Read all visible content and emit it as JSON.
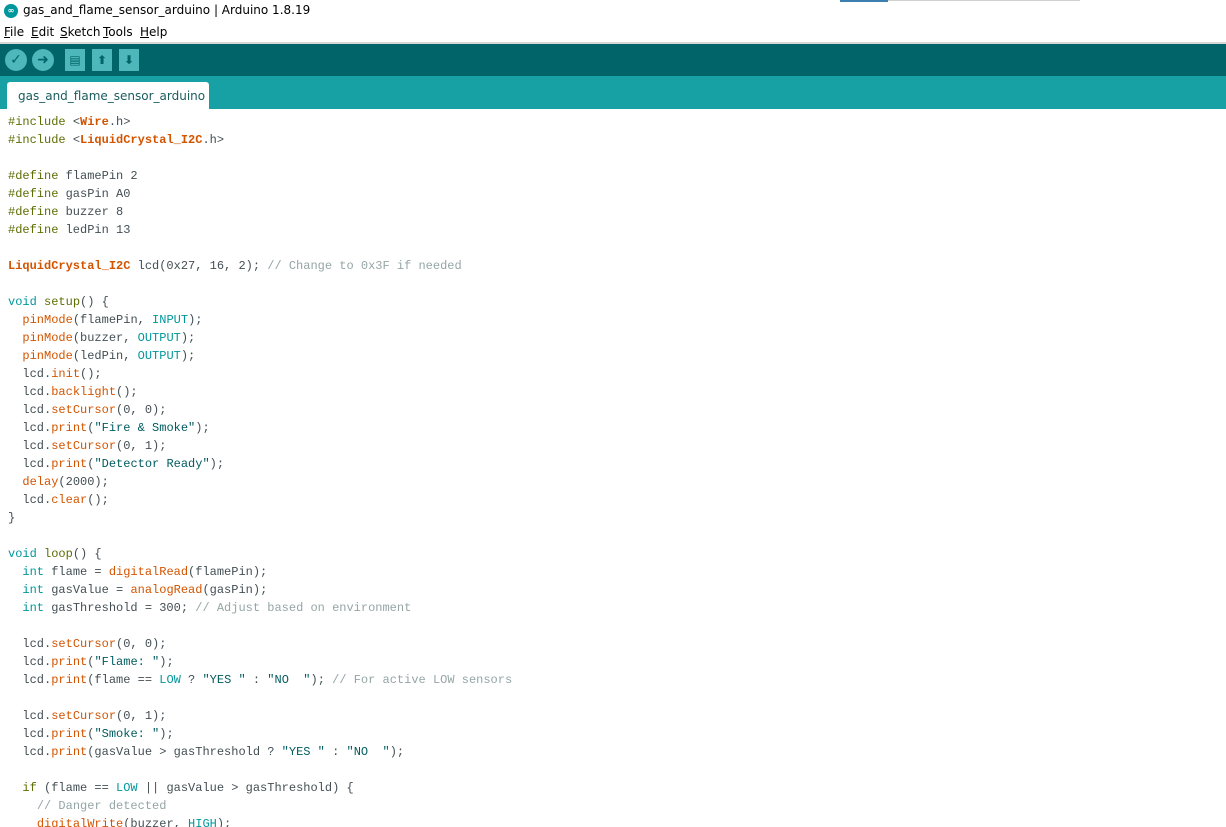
{
  "window": {
    "title": "gas_and_flame_sensor_arduino | Arduino 1.8.19"
  },
  "menu": {
    "items": [
      {
        "key": "F",
        "rest": "ile"
      },
      {
        "key": "E",
        "rest": "dit"
      },
      {
        "key": "S",
        "rest": "ketch"
      },
      {
        "key": "T",
        "rest": "ools"
      },
      {
        "key": "H",
        "rest": "elp"
      }
    ]
  },
  "toolbar": {
    "buttons": [
      {
        "name": "verify-button",
        "icon": "check-icon",
        "glyph": "✓"
      },
      {
        "name": "upload-button",
        "icon": "arrow-right-icon",
        "glyph": "➜"
      },
      {
        "name": "new-button",
        "icon": "new-file-icon",
        "glyph": "▤"
      },
      {
        "name": "open-button",
        "icon": "arrow-up-icon",
        "glyph": "⬆"
      },
      {
        "name": "save-button",
        "icon": "arrow-down-icon",
        "glyph": "⬇"
      }
    ]
  },
  "tab": {
    "label": "gas_and_flame_sensor_arduino"
  },
  "colors": {
    "toolbar": "#006468",
    "tabbar": "#17a1a5",
    "keyword": "#5e6d03",
    "type": "#00979c",
    "function": "#d35400",
    "string": "#005c5f",
    "comment": "#95a5a6"
  },
  "code": [
    [
      [
        "kw",
        "#include "
      ],
      [
        "pl",
        "<"
      ],
      [
        "cls",
        "Wire"
      ],
      [
        "pl",
        ".h>"
      ]
    ],
    [
      [
        "kw",
        "#include "
      ],
      [
        "pl",
        "<"
      ],
      [
        "cls",
        "LiquidCrystal_I2C"
      ],
      [
        "pl",
        ".h>"
      ]
    ],
    [],
    [
      [
        "kw",
        "#define "
      ],
      [
        "pl",
        "flamePin 2"
      ]
    ],
    [
      [
        "kw",
        "#define "
      ],
      [
        "pl",
        "gasPin A0"
      ]
    ],
    [
      [
        "kw",
        "#define "
      ],
      [
        "pl",
        "buzzer 8"
      ]
    ],
    [
      [
        "kw",
        "#define "
      ],
      [
        "pl",
        "ledPin 13"
      ]
    ],
    [],
    [
      [
        "cls",
        "LiquidCrystal_I2C"
      ],
      [
        "pl",
        " lcd(0x27, 16, 2); "
      ],
      [
        "cm",
        "// Change to 0x3F if needed"
      ]
    ],
    [],
    [
      [
        "ty",
        "void "
      ],
      [
        "kw",
        "setup"
      ],
      [
        "pl",
        "() {"
      ]
    ],
    [
      [
        "pl",
        "  "
      ],
      [
        "fn",
        "pinMode"
      ],
      [
        "pl",
        "(flamePin, "
      ],
      [
        "cn",
        "INPUT"
      ],
      [
        "pl",
        ");"
      ]
    ],
    [
      [
        "pl",
        "  "
      ],
      [
        "fn",
        "pinMode"
      ],
      [
        "pl",
        "(buzzer, "
      ],
      [
        "cn",
        "OUTPUT"
      ],
      [
        "pl",
        ");"
      ]
    ],
    [
      [
        "pl",
        "  "
      ],
      [
        "fn",
        "pinMode"
      ],
      [
        "pl",
        "(ledPin, "
      ],
      [
        "cn",
        "OUTPUT"
      ],
      [
        "pl",
        ");"
      ]
    ],
    [
      [
        "pl",
        "  lcd."
      ],
      [
        "fn",
        "init"
      ],
      [
        "pl",
        "();"
      ]
    ],
    [
      [
        "pl",
        "  lcd."
      ],
      [
        "fn",
        "backlight"
      ],
      [
        "pl",
        "();"
      ]
    ],
    [
      [
        "pl",
        "  lcd."
      ],
      [
        "fn",
        "setCursor"
      ],
      [
        "pl",
        "(0, 0);"
      ]
    ],
    [
      [
        "pl",
        "  lcd."
      ],
      [
        "fn",
        "print"
      ],
      [
        "pl",
        "("
      ],
      [
        "str",
        "\"Fire & Smoke\""
      ],
      [
        "pl",
        ");"
      ]
    ],
    [
      [
        "pl",
        "  lcd."
      ],
      [
        "fn",
        "setCursor"
      ],
      [
        "pl",
        "(0, 1);"
      ]
    ],
    [
      [
        "pl",
        "  lcd."
      ],
      [
        "fn",
        "print"
      ],
      [
        "pl",
        "("
      ],
      [
        "str",
        "\"Detector Ready\""
      ],
      [
        "pl",
        ");"
      ]
    ],
    [
      [
        "pl",
        "  "
      ],
      [
        "fn",
        "delay"
      ],
      [
        "pl",
        "(2000);"
      ]
    ],
    [
      [
        "pl",
        "  lcd."
      ],
      [
        "fn",
        "clear"
      ],
      [
        "pl",
        "();"
      ]
    ],
    [
      [
        "pl",
        "}"
      ]
    ],
    [],
    [
      [
        "ty",
        "void "
      ],
      [
        "kw",
        "loop"
      ],
      [
        "pl",
        "() {"
      ]
    ],
    [
      [
        "pl",
        "  "
      ],
      [
        "ty",
        "int"
      ],
      [
        "pl",
        " flame = "
      ],
      [
        "fn",
        "digitalRead"
      ],
      [
        "pl",
        "(flamePin);"
      ]
    ],
    [
      [
        "pl",
        "  "
      ],
      [
        "ty",
        "int"
      ],
      [
        "pl",
        " gasValue = "
      ],
      [
        "fn",
        "analogRead"
      ],
      [
        "pl",
        "(gasPin);"
      ]
    ],
    [
      [
        "pl",
        "  "
      ],
      [
        "ty",
        "int"
      ],
      [
        "pl",
        " gasThreshold = 300; "
      ],
      [
        "cm",
        "// Adjust based on environment"
      ]
    ],
    [],
    [
      [
        "pl",
        "  lcd."
      ],
      [
        "fn",
        "setCursor"
      ],
      [
        "pl",
        "(0, 0);"
      ]
    ],
    [
      [
        "pl",
        "  lcd."
      ],
      [
        "fn",
        "print"
      ],
      [
        "pl",
        "("
      ],
      [
        "str",
        "\"Flame: \""
      ],
      [
        "pl",
        ");"
      ]
    ],
    [
      [
        "pl",
        "  lcd."
      ],
      [
        "fn",
        "print"
      ],
      [
        "pl",
        "(flame == "
      ],
      [
        "cn",
        "LOW"
      ],
      [
        "pl",
        " ? "
      ],
      [
        "str",
        "\"YES \""
      ],
      [
        "pl",
        " : "
      ],
      [
        "str",
        "\"NO  \""
      ],
      [
        "pl",
        "); "
      ],
      [
        "cm",
        "// For active LOW sensors"
      ]
    ],
    [],
    [
      [
        "pl",
        "  lcd."
      ],
      [
        "fn",
        "setCursor"
      ],
      [
        "pl",
        "(0, 1);"
      ]
    ],
    [
      [
        "pl",
        "  lcd."
      ],
      [
        "fn",
        "print"
      ],
      [
        "pl",
        "("
      ],
      [
        "str",
        "\"Smoke: \""
      ],
      [
        "pl",
        ");"
      ]
    ],
    [
      [
        "pl",
        "  lcd."
      ],
      [
        "fn",
        "print"
      ],
      [
        "pl",
        "(gasValue > gasThreshold ? "
      ],
      [
        "str",
        "\"YES \""
      ],
      [
        "pl",
        " : "
      ],
      [
        "str",
        "\"NO  \""
      ],
      [
        "pl",
        ");"
      ]
    ],
    [],
    [
      [
        "pl",
        "  "
      ],
      [
        "kw",
        "if"
      ],
      [
        "pl",
        " (flame == "
      ],
      [
        "cn",
        "LOW"
      ],
      [
        "pl",
        " || gasValue > gasThreshold) {"
      ]
    ],
    [
      [
        "pl",
        "    "
      ],
      [
        "cm",
        "// Danger detected"
      ]
    ],
    [
      [
        "pl",
        "    "
      ],
      [
        "fn",
        "digitalWrite"
      ],
      [
        "pl",
        "(buzzer, "
      ],
      [
        "cn",
        "HIGH"
      ],
      [
        "pl",
        ");"
      ]
    ]
  ]
}
